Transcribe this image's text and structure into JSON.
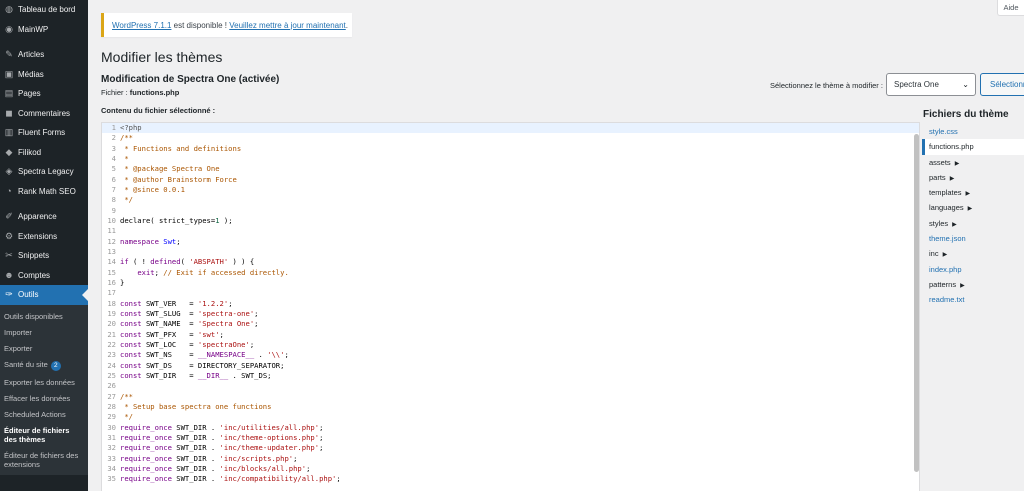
{
  "sidebar": {
    "items": [
      {
        "label": "Tableau de bord",
        "icon": "dashboard-icon",
        "glyph": "◍"
      },
      {
        "label": "MainWP",
        "icon": "mainwp-icon",
        "glyph": "◉"
      },
      {
        "sep": true
      },
      {
        "label": "Articles",
        "icon": "pin-icon",
        "glyph": "✎"
      },
      {
        "label": "Médias",
        "icon": "media-icon",
        "glyph": "▣"
      },
      {
        "label": "Pages",
        "icon": "pages-icon",
        "glyph": "▤"
      },
      {
        "label": "Commentaires",
        "icon": "comments-icon",
        "glyph": "◼"
      },
      {
        "label": "Fluent Forms",
        "icon": "forms-icon",
        "glyph": "▥"
      },
      {
        "label": "Filikod",
        "icon": "filikod-icon",
        "glyph": "◆"
      },
      {
        "label": "Spectra Legacy",
        "icon": "spectra-icon",
        "glyph": "◈"
      },
      {
        "label": "Rank Math SEO",
        "icon": "rankmath-icon",
        "glyph": "◔"
      },
      {
        "sep": true
      },
      {
        "label": "Apparence",
        "icon": "brush-icon",
        "glyph": "✐"
      },
      {
        "label": "Extensions",
        "icon": "plugin-icon",
        "glyph": "⚙"
      },
      {
        "label": "Snippets",
        "icon": "snippets-icon",
        "glyph": "✂"
      },
      {
        "label": "Comptes",
        "icon": "users-icon",
        "glyph": "☻"
      },
      {
        "label": "Outils",
        "icon": "wrench-icon",
        "glyph": "✑",
        "active": true
      }
    ],
    "submenu": [
      {
        "label": "Outils disponibles"
      },
      {
        "label": "Importer"
      },
      {
        "label": "Exporter"
      },
      {
        "label": "Santé du site",
        "badge": "2"
      },
      {
        "label": "Exporter les données"
      },
      {
        "label": "Effacer les données"
      },
      {
        "label": "Scheduled Actions"
      },
      {
        "label": "Éditeur de fichiers des thèmes",
        "current": true
      },
      {
        "label": "Éditeur de fichiers des extensions"
      }
    ]
  },
  "help_label": "Aide",
  "notice": {
    "version_link": "WordPress 7.1.1",
    "text": " est disponible ! ",
    "update_link": "Veuillez mettre à jour maintenant",
    "end": "."
  },
  "page_title": "Modifier les thèmes",
  "file_heading": "Modification de Spectra One (activée)",
  "file_prefix": "Fichier : ",
  "file_name": "functions.php",
  "content_label": "Contenu du fichier sélectionné :",
  "theme_select": {
    "label": "Sélectionnez le thème à modifier :",
    "value": "Spectra One",
    "button": "Sélectionner"
  },
  "code_lines": [
    [
      {
        "t": "<?php",
        "c": "meta"
      }
    ],
    [
      {
        "t": "/**",
        "c": "comment"
      }
    ],
    [
      {
        "t": " * Functions and definitions",
        "c": "comment"
      }
    ],
    [
      {
        "t": " *",
        "c": "comment"
      }
    ],
    [
      {
        "t": " * @package Spectra One",
        "c": "comment"
      }
    ],
    [
      {
        "t": " * @author Brainstorm Force",
        "c": "comment"
      }
    ],
    [
      {
        "t": " * @since 0.0.1",
        "c": "comment"
      }
    ],
    [
      {
        "t": " */",
        "c": "comment"
      }
    ],
    [],
    [
      {
        "t": "declare",
        "c": ""
      },
      {
        "t": "( strict_types=",
        "c": ""
      },
      {
        "t": "1",
        "c": "num"
      },
      {
        "t": " );",
        "c": ""
      }
    ],
    [],
    [
      {
        "t": "namespace",
        "c": "kw"
      },
      {
        "t": " ",
        "c": ""
      },
      {
        "t": "Swt",
        "c": "def"
      },
      {
        "t": ";",
        "c": ""
      }
    ],
    [],
    [
      {
        "t": "if",
        "c": "kw"
      },
      {
        "t": " ( ! ",
        "c": ""
      },
      {
        "t": "defined",
        "c": "kw"
      },
      {
        "t": "( ",
        "c": ""
      },
      {
        "t": "'ABSPATH'",
        "c": "str"
      },
      {
        "t": " ) ) {",
        "c": ""
      }
    ],
    [
      {
        "t": "    ",
        "c": ""
      },
      {
        "t": "exit",
        "c": "kw"
      },
      {
        "t": "; ",
        "c": ""
      },
      {
        "t": "// Exit if accessed directly.",
        "c": "comment"
      }
    ],
    [
      {
        "t": "}",
        "c": ""
      }
    ],
    [],
    [
      {
        "t": "const",
        "c": "kw"
      },
      {
        "t": " SWT_VER   = ",
        "c": ""
      },
      {
        "t": "'1.2.2'",
        "c": "str"
      },
      {
        "t": ";",
        "c": ""
      }
    ],
    [
      {
        "t": "const",
        "c": "kw"
      },
      {
        "t": " SWT_SLUG  = ",
        "c": ""
      },
      {
        "t": "'spectra-one'",
        "c": "str"
      },
      {
        "t": ";",
        "c": ""
      }
    ],
    [
      {
        "t": "const",
        "c": "kw"
      },
      {
        "t": " SWT_NAME  = ",
        "c": ""
      },
      {
        "t": "'Spectra One'",
        "c": "str"
      },
      {
        "t": ";",
        "c": ""
      }
    ],
    [
      {
        "t": "const",
        "c": "kw"
      },
      {
        "t": " SWT_PFX   = ",
        "c": ""
      },
      {
        "t": "'swt'",
        "c": "str"
      },
      {
        "t": ";",
        "c": ""
      }
    ],
    [
      {
        "t": "const",
        "c": "kw"
      },
      {
        "t": " SWT_LOC   = ",
        "c": ""
      },
      {
        "t": "'spectraOne'",
        "c": "str"
      },
      {
        "t": ";",
        "c": ""
      }
    ],
    [
      {
        "t": "const",
        "c": "kw"
      },
      {
        "t": " SWT_NS    = ",
        "c": ""
      },
      {
        "t": "__NAMESPACE__",
        "c": "kw"
      },
      {
        "t": " . ",
        "c": ""
      },
      {
        "t": "'\\\\'",
        "c": "str"
      },
      {
        "t": ";",
        "c": ""
      }
    ],
    [
      {
        "t": "const",
        "c": "kw"
      },
      {
        "t": " SWT_DS    = DIRECTORY_SEPARATOR;",
        "c": ""
      }
    ],
    [
      {
        "t": "const",
        "c": "kw"
      },
      {
        "t": " SWT_DIR   = ",
        "c": ""
      },
      {
        "t": "__DIR__",
        "c": "kw"
      },
      {
        "t": " . SWT_DS;",
        "c": ""
      }
    ],
    [],
    [
      {
        "t": "/**",
        "c": "comment"
      }
    ],
    [
      {
        "t": " * Setup base spectra one functions",
        "c": "comment"
      }
    ],
    [
      {
        "t": " */",
        "c": "comment"
      }
    ],
    [
      {
        "t": "require_once",
        "c": "kw"
      },
      {
        "t": " SWT_DIR . ",
        "c": ""
      },
      {
        "t": "'inc/utilities/all.php'",
        "c": "str"
      },
      {
        "t": ";",
        "c": ""
      }
    ],
    [
      {
        "t": "require_once",
        "c": "kw"
      },
      {
        "t": " SWT_DIR . ",
        "c": ""
      },
      {
        "t": "'inc/theme-options.php'",
        "c": "str"
      },
      {
        "t": ";",
        "c": ""
      }
    ],
    [
      {
        "t": "require_once",
        "c": "kw"
      },
      {
        "t": " SWT_DIR . ",
        "c": ""
      },
      {
        "t": "'inc/theme-updater.php'",
        "c": "str"
      },
      {
        "t": ";",
        "c": ""
      }
    ],
    [
      {
        "t": "require_once",
        "c": "kw"
      },
      {
        "t": " SWT_DIR . ",
        "c": ""
      },
      {
        "t": "'inc/scripts.php'",
        "c": "str"
      },
      {
        "t": ";",
        "c": ""
      }
    ],
    [
      {
        "t": "require_once",
        "c": "kw"
      },
      {
        "t": " SWT_DIR . ",
        "c": ""
      },
      {
        "t": "'inc/blocks/all.php'",
        "c": "str"
      },
      {
        "t": ";",
        "c": ""
      }
    ],
    [
      {
        "t": "require_once",
        "c": "kw"
      },
      {
        "t": " SWT_DIR . ",
        "c": ""
      },
      {
        "t": "'inc/compatibility/all.php'",
        "c": "str"
      },
      {
        "t": ";",
        "c": ""
      }
    ]
  ],
  "theme_files": {
    "title": "Fichiers du thème",
    "items": [
      {
        "label": "style.css",
        "type": "link"
      },
      {
        "label": "functions.php",
        "type": "current"
      },
      {
        "label": "assets",
        "type": "folder"
      },
      {
        "label": "parts",
        "type": "folder"
      },
      {
        "label": "templates",
        "type": "folder"
      },
      {
        "label": "languages",
        "type": "folder"
      },
      {
        "label": "styles",
        "type": "folder"
      },
      {
        "label": "theme.json",
        "type": "link"
      },
      {
        "label": "inc",
        "type": "folder"
      },
      {
        "label": "index.php",
        "type": "link"
      },
      {
        "label": "patterns",
        "type": "folder"
      },
      {
        "label": "readme.txt",
        "type": "link"
      }
    ]
  },
  "colors": {
    "sidebar_bg": "#1d2327",
    "accent": "#2271b1",
    "notice_border": "#dba617"
  }
}
